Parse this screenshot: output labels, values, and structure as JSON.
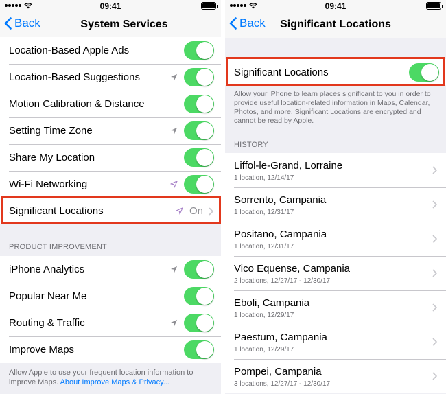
{
  "colors": {
    "accent": "#007aff",
    "toggle_on": "#4cd964",
    "highlight": "#e2381d",
    "secondary_text": "#6d6d72"
  },
  "status_bar": {
    "time": "09:41"
  },
  "left": {
    "back_label": "Back",
    "title": "System Services",
    "items": [
      {
        "label": "Location-Based Apple Ads",
        "arrow": "none",
        "toggle": "on"
      },
      {
        "label": "Location-Based Suggestions",
        "arrow": "gray",
        "toggle": "on"
      },
      {
        "label": "Motion Calibration & Distance",
        "arrow": "none",
        "toggle": "on"
      },
      {
        "label": "Setting Time Zone",
        "arrow": "gray",
        "toggle": "on"
      },
      {
        "label": "Share My Location",
        "arrow": "none",
        "toggle": "on"
      },
      {
        "label": "Wi-Fi Networking",
        "arrow": "purple",
        "toggle": "on"
      },
      {
        "label": "Significant Locations",
        "arrow": "purple",
        "value": "On"
      }
    ],
    "product_improvement_header": "PRODUCT IMPROVEMENT",
    "product_items": [
      {
        "label": "iPhone Analytics",
        "arrow": "gray",
        "toggle": "on"
      },
      {
        "label": "Popular Near Me",
        "arrow": "none",
        "toggle": "on"
      },
      {
        "label": "Routing & Traffic",
        "arrow": "gray",
        "toggle": "on"
      },
      {
        "label": "Improve Maps",
        "arrow": "none",
        "toggle": "on"
      }
    ],
    "footer_text": "Allow Apple to use your frequent location information to improve Maps. ",
    "footer_link": "About Improve Maps & Privacy..."
  },
  "right": {
    "back_label": "Back",
    "title": "Significant Locations",
    "toggle_label": "Significant Locations",
    "toggle": "on",
    "description": "Allow your iPhone to learn places significant to you in order to provide useful location-related information in Maps, Calendar, Photos, and more. Significant Locations are encrypted and cannot be read by Apple.",
    "history_header": "HISTORY",
    "history": [
      {
        "place": "Liffol-le-Grand, Lorraine",
        "meta": "1 location, 12/14/17"
      },
      {
        "place": "Sorrento, Campania",
        "meta": "1 location, 12/31/17"
      },
      {
        "place": "Positano, Campania",
        "meta": "1 location, 12/31/17"
      },
      {
        "place": "Vico Equense, Campania",
        "meta": "2 locations, 12/27/17 - 12/30/17"
      },
      {
        "place": "Eboli, Campania",
        "meta": "1 location, 12/29/17"
      },
      {
        "place": "Paestum, Campania",
        "meta": "1 location, 12/29/17"
      },
      {
        "place": "Pompei, Campania",
        "meta": "3 locations, 12/27/17 - 12/30/17"
      }
    ]
  }
}
